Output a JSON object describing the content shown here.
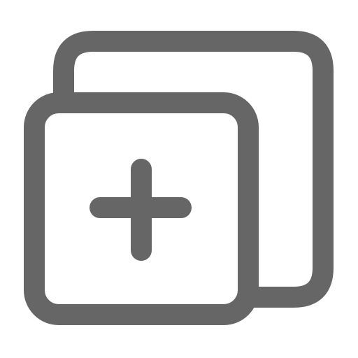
{
  "icon": {
    "name": "add-copy-icon",
    "stroke_color": "#666666",
    "background_color": "#ffffff"
  }
}
